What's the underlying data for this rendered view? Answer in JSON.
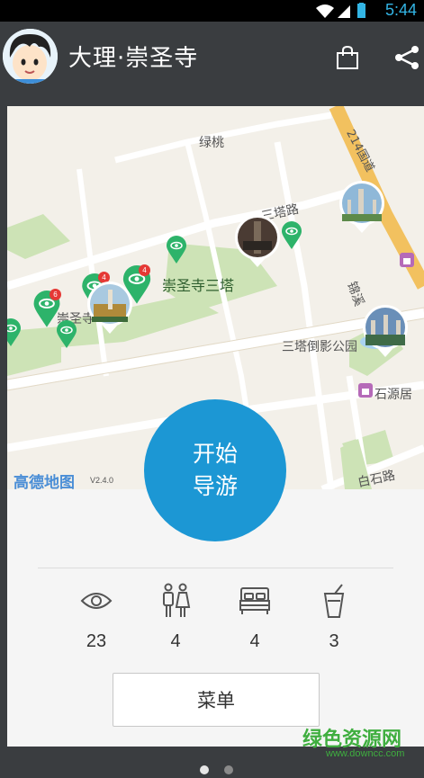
{
  "status_bar": {
    "time": "5:44"
  },
  "header": {
    "title": "大理·崇圣寺",
    "bag_icon": "shopping-bag-icon",
    "share_icon": "share-icon"
  },
  "map": {
    "labels": {
      "lutao": "绿桃",
      "road214": "214国道",
      "santa_road": "三塔路",
      "chongsheng_santa": "崇圣寺三塔",
      "chongsheng_si": "崇圣寺",
      "jinxiu": "锦溪",
      "santa_daoying": "三塔倒影公园",
      "shiyuan": "石源居",
      "baishi_road": "白石路"
    },
    "pins": [
      {
        "badge": "6"
      },
      {
        "badge": "4"
      },
      {
        "badge": "4"
      }
    ],
    "logo": "高德地图",
    "version": "V2.4.0"
  },
  "start_button": {
    "line1": "开始",
    "line2": "导游"
  },
  "stats": [
    {
      "icon": "eye-icon",
      "value": "23"
    },
    {
      "icon": "restroom-icon",
      "value": "4"
    },
    {
      "icon": "bed-icon",
      "value": "4"
    },
    {
      "icon": "drink-icon",
      "value": "3"
    }
  ],
  "menu_button": {
    "label": "菜单"
  },
  "watermark": {
    "title": "绿色资源网",
    "url": "www.downcc.com"
  },
  "pager": {
    "active_color": "#e6e6e6",
    "inactive_color": "#8a8a8a"
  },
  "colors": {
    "accent": "#1c97d4",
    "appbar": "#3a3d40",
    "status_time": "#33b5e5",
    "pin_green": "#2db36a"
  }
}
